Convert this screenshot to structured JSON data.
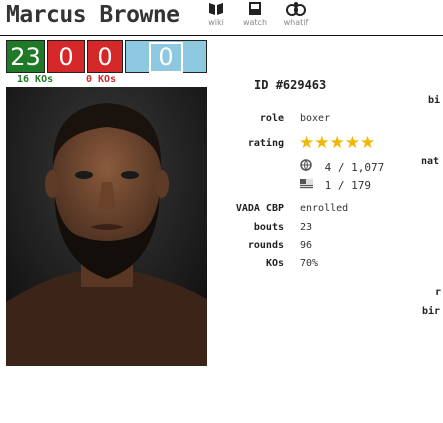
{
  "header": {
    "boxer_name": "Marcus Browne",
    "nav": [
      {
        "label": "wiki",
        "icon": "book-icon"
      },
      {
        "label": "watch",
        "icon": "film-icon"
      },
      {
        "label": "whatif",
        "icon": "whatif-icon"
      }
    ]
  },
  "record": {
    "wins": "23",
    "losses": "0",
    "losses_alt": "0",
    "draws": "0",
    "wins_ko": "16 KOs",
    "losses_ko": "0 KOs"
  },
  "colors": {
    "win": "#1e7a26",
    "loss": "#d62828",
    "draw": "#8ec7e0",
    "star": "#f2b705"
  },
  "profile": {
    "id_label": "ID",
    "id_value": "#629463",
    "role_label": "role",
    "role_value": "boxer",
    "rating_label": "rating",
    "rating_stars": "★★★★★",
    "rank_world": "4 / 1,077",
    "rank_national": "1 / 179",
    "vada_label": "VADA CBP",
    "vada_value": "enrolled",
    "bouts_label": "bouts",
    "bouts_value": "23",
    "rounds_label": "rounds",
    "rounds_value": "96",
    "kos_label": "KOs",
    "kos_value": "70%"
  },
  "cut_labels": {
    "bi": "bi",
    "nat": "nat",
    "r": "r",
    "bir": "bir"
  }
}
